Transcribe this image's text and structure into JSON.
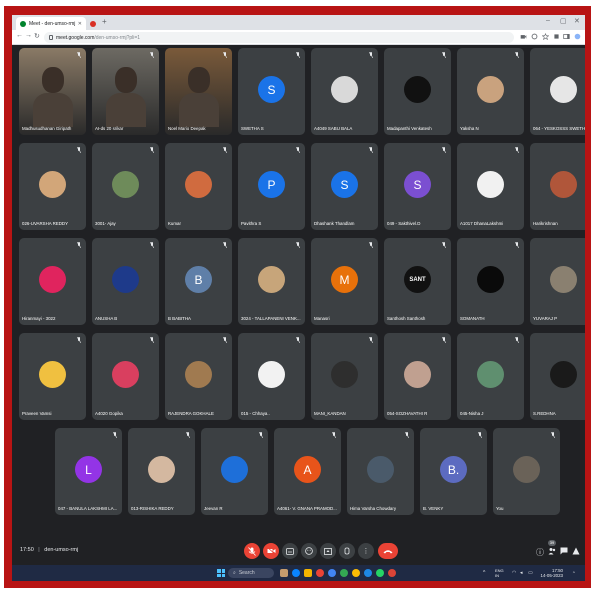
{
  "browser": {
    "tabs": [
      {
        "label": "Meet - den-umso-rmj",
        "active": true
      },
      {
        "label": "",
        "active": false
      }
    ],
    "new_tab": "+",
    "url_host": "meet.google.com",
    "url_path": "/den-umso-rmj?pli=1"
  },
  "participants": [
    {
      "name": "Madhusudhanan Giripath",
      "kind": "video",
      "color": "#8a7a66"
    },
    {
      "name": "AI-ds 20 srikar",
      "kind": "video",
      "color": "#6d6a63"
    },
    {
      "name": "Noel Mario Deepak",
      "kind": "video",
      "color": "#7a5a3a"
    },
    {
      "name": "SWETHA S",
      "kind": "letter",
      "letter": "S",
      "color": "#1a73e8"
    },
    {
      "name": "A4049 SABU BALA",
      "kind": "photo",
      "color": "#d9d9d9"
    },
    {
      "name": "Madapanthi Venkatesh",
      "kind": "photo",
      "color": "#111111"
    },
    {
      "name": "Yaksha N",
      "kind": "photo",
      "color": "#c9a27e"
    },
    {
      "name": "064 - YESKOSSS SWETHA",
      "kind": "photo",
      "color": "#e6e6e6"
    },
    {
      "name": "026-UVARSHA REDDY",
      "kind": "photo",
      "color": "#d2a679"
    },
    {
      "name": "3001- Ajay",
      "kind": "photo",
      "color": "#6e8b5a"
    },
    {
      "name": "Kumar",
      "kind": "photo",
      "color": "#d06b3f"
    },
    {
      "name": "Pavithra S",
      "kind": "letter",
      "letter": "P",
      "color": "#1a73e8"
    },
    {
      "name": "Dhashank Thandlam",
      "kind": "letter",
      "letter": "S",
      "color": "#1a73e8"
    },
    {
      "name": "049 - Sakthivel.D",
      "kind": "letter",
      "letter": "S",
      "color": "#7b4fd1"
    },
    {
      "name": "A1017 DhanaLakshmi",
      "kind": "photo",
      "color": "#f1f1f1"
    },
    {
      "name": "Harikrishnan",
      "kind": "photo",
      "color": "#b0563a"
    },
    {
      "name": "Hiranmayi - 3022",
      "kind": "photo",
      "color": "#e0245e"
    },
    {
      "name": "ANUSHA B",
      "kind": "photo",
      "color": "#1e3a8a"
    },
    {
      "name": "B BABITHA",
      "kind": "letter",
      "letter": "B",
      "color": "#5f7fa8"
    },
    {
      "name": "3024 - TALLAPANENI VENK...",
      "kind": "photo",
      "color": "#c7a57a"
    },
    {
      "name": "Manasri",
      "kind": "letter",
      "letter": "M",
      "color": "#e8710a"
    },
    {
      "name": "Santhosh Santhosh",
      "kind": "photo",
      "color": "#111111",
      "label": "SANT"
    },
    {
      "name": "SOMANATH",
      "kind": "photo",
      "color": "#0a0a0a"
    },
    {
      "name": "YUVARAJ P",
      "kind": "photo",
      "color": "#8a8070"
    },
    {
      "name": "Praveen Vamsi",
      "kind": "photo",
      "color": "#f0c040"
    },
    {
      "name": "A4020 Gopika",
      "kind": "photo",
      "color": "#d93f5f"
    },
    {
      "name": "RAJENDRA GOKHALE",
      "kind": "photo",
      "color": "#a07a50"
    },
    {
      "name": "015 - Chhaya..",
      "kind": "photo",
      "color": "#f2f2f2"
    },
    {
      "name": "MANI_KANDAN",
      "kind": "photo",
      "color": "#2e2e2e"
    },
    {
      "name": "054-SOZHAVATHI R",
      "kind": "photo",
      "color": "#c0a090"
    },
    {
      "name": "045-Nisha J",
      "kind": "photo",
      "color": "#5f8f6f"
    },
    {
      "name": "S.REDHNA",
      "kind": "photo",
      "color": "#1a1a1a"
    },
    {
      "name": "047 - BANULA LAKSHMI LA...",
      "kind": "letter",
      "letter": "L",
      "color": "#9334e6"
    },
    {
      "name": "013-RISHIKA REDDY",
      "kind": "photo",
      "color": "#d4b8a0"
    },
    {
      "name": "Jeevan R",
      "kind": "photo",
      "color": "#1e6fd9"
    },
    {
      "name": "A4061- V. GNANA PRAMOD...",
      "kind": "letter",
      "letter": "A",
      "color": "#e8541a"
    },
    {
      "name": "Hima Varsha Chowdary",
      "kind": "photo",
      "color": "#4a5a6a"
    },
    {
      "name": "B. VENKY",
      "kind": "letter",
      "letter": "B.",
      "color": "#5c6bc0"
    },
    {
      "name": "You",
      "kind": "photo",
      "color": "#6a6258"
    }
  ],
  "meeting": {
    "time": "17:50",
    "code": "den-umso-rmj",
    "people_count": "39"
  },
  "taskbar": {
    "search_label": "Search",
    "lang_top": "ENG",
    "lang_bottom": "IN",
    "time": "17:50",
    "date": "14-05-2023"
  },
  "colors": {
    "frame": "#b81414",
    "meet_bg": "#202124",
    "tile_bg": "#3c4043",
    "hangup": "#ea4335"
  }
}
